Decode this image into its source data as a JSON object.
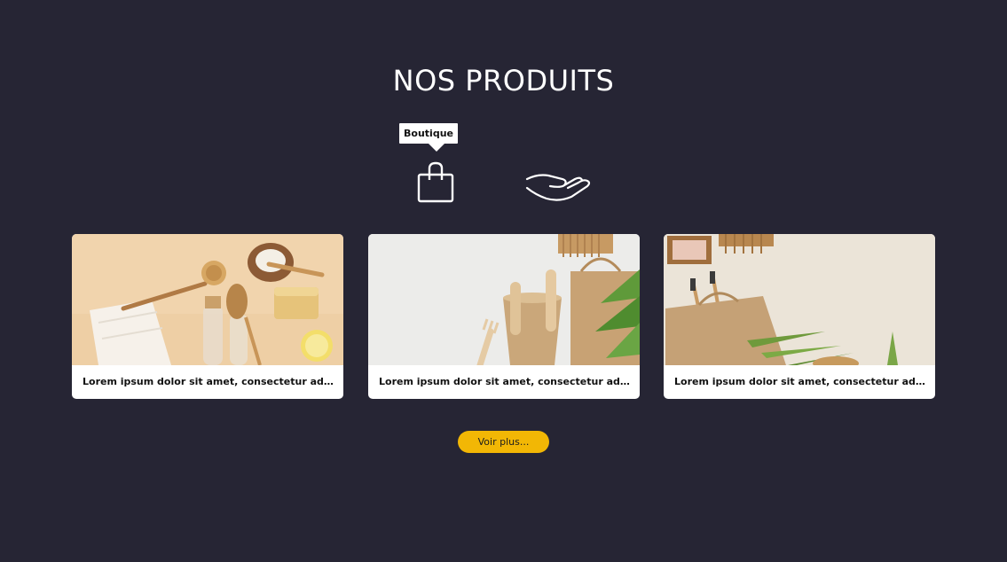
{
  "section": {
    "title": "NOS PRODUITS"
  },
  "tabs": [
    {
      "icon": "shopping-bag-icon",
      "tooltip": "Boutique",
      "active": true
    },
    {
      "icon": "open-hand-icon",
      "tooltip": "",
      "active": false
    }
  ],
  "products": [
    {
      "caption": "Lorem ipsum dolor sit amet, consectetur adipisicing..."
    },
    {
      "caption": "Lorem ipsum dolor sit amet, consectetur adipisicing..."
    },
    {
      "caption": "Lorem ipsum dolor sit amet, consectetur adipisicing..."
    }
  ],
  "more_button": {
    "label": "Voir plus..."
  },
  "colors": {
    "background": "#262534",
    "accent": "#f2b705",
    "card": "#ffffff"
  }
}
